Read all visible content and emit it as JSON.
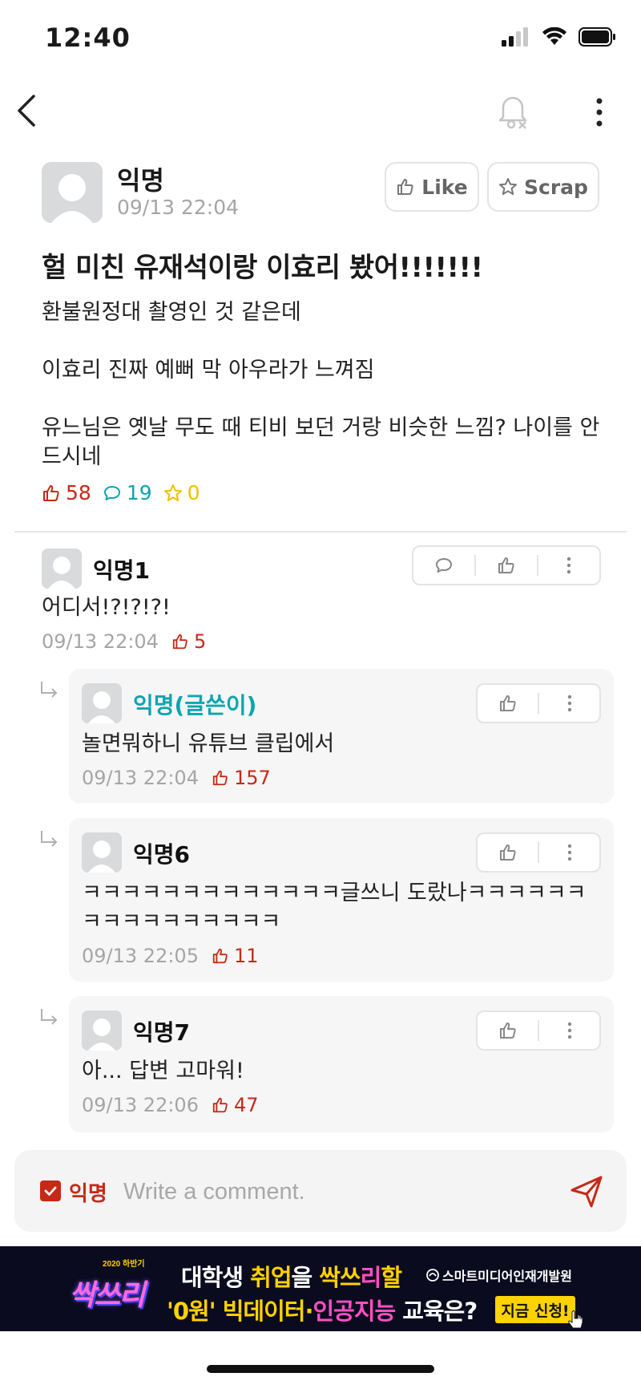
{
  "status_bar": {
    "time": "12:40"
  },
  "post": {
    "author": "익명",
    "timestamp": "09/13 22:04",
    "like_label": "Like",
    "scrap_label": "Scrap",
    "title": "헐 미친 유재석이랑 이효리 봤어!!!!!!!",
    "body": [
      "환불원정대 촬영인 것 같은데",
      "이효리 진짜 예뻐 막 아우라가 느껴짐",
      "유느님은 옛날 무도 때 티비 보던 거랑 비슷한 느낌? 나이를 안드시네"
    ],
    "likes": "58",
    "comments": "19",
    "scraps": "0"
  },
  "comments": [
    {
      "author": "익명1",
      "text": "어디서!?!?!?!",
      "timestamp": "09/13 22:04",
      "likes": "5"
    }
  ],
  "replies": [
    {
      "author": "익명(글쓴이)",
      "text": "놀면뭐하니 유튜브 클립에서",
      "timestamp": "09/13 22:04",
      "likes": "157"
    },
    {
      "author": "익명6",
      "text": "ㅋㅋㅋㅋㅋㅋㅋㅋㅋㅋㅋㅋㅋ글쓰니 도랐나ㅋㅋㅋㅋㅋㅋㅋㅋㅋㅋㅋㅋㅋㅋㅋㅋ",
      "timestamp": "09/13 22:05",
      "likes": "11"
    },
    {
      "author": "익명7",
      "text": "아... 답변 고마워!",
      "timestamp": "09/13 22:06",
      "likes": "47"
    }
  ],
  "comment_input": {
    "anonymous_label": "익명",
    "placeholder": "Write a comment."
  },
  "banner": {
    "logo_small": "2020 하반기",
    "logo_big": "싹쓰리",
    "line1_a": "대학생 ",
    "line1_b": "취업",
    "line1_c": "을 ",
    "line1_d": "싹쓰",
    "line1_e": "리",
    "line1_f": "할",
    "line2_a": "'0원'",
    "line2_b": " 빅데이터·",
    "line2_c": "인공지능",
    "line2_d": " 교육은?",
    "org": "스마트미디어인재개발원",
    "cta": "지금 신청!"
  },
  "colors": {
    "accent_red": "#c62917",
    "teal": "#0ca5b0",
    "yellow": "#f0c000",
    "meta_gray": "#a5a5a5"
  },
  "icons": [
    "back-icon",
    "bell-off-icon",
    "more-vertical-icon",
    "thumbs-up-icon",
    "star-icon",
    "comment-icon",
    "reply-arrow-icon",
    "send-icon",
    "checkbox-icon"
  ]
}
